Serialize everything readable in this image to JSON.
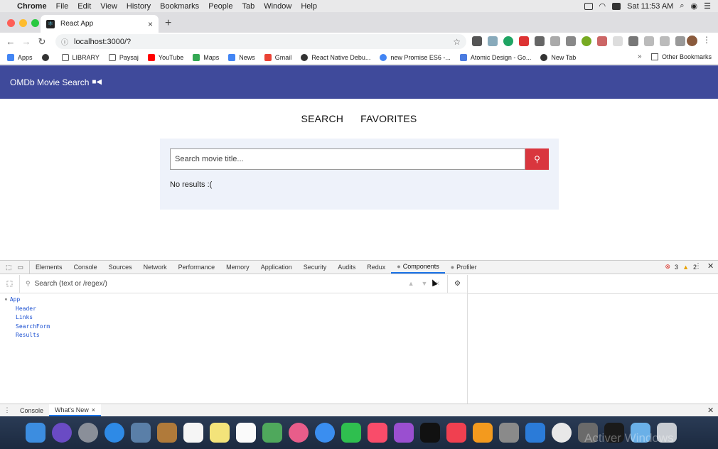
{
  "menubar": {
    "items": [
      "Chrome",
      "File",
      "Edit",
      "View",
      "History",
      "Bookmarks",
      "People",
      "Tab",
      "Window",
      "Help"
    ],
    "clock": "Sat 11:53 AM"
  },
  "browser": {
    "tab_title": "React App",
    "url": "localhost:3000/?"
  },
  "bookmarks": [
    "Apps",
    "LIBRARY",
    "Paysaj",
    "YouTube",
    "Maps",
    "News",
    "Gmail",
    "React Native Debu...",
    "new Promise ES6 -...",
    "Atomic Design - Go...",
    "New Tab"
  ],
  "bookmarks_right": "Other Bookmarks",
  "app": {
    "brand": "OMDb Movie Search",
    "nav": [
      "SEARCH",
      "FAVORITES"
    ],
    "search_placeholder": "Search movie title...",
    "no_results": "No results :("
  },
  "devtools": {
    "tabs": [
      "Elements",
      "Console",
      "Sources",
      "Network",
      "Performance",
      "Memory",
      "Application",
      "Security",
      "Audits",
      "Redux",
      "Components",
      "Profiler"
    ],
    "active_tab": "Components",
    "error_count": "3",
    "warning_count": "2",
    "search_placeholder": "Search (text or /regex/)",
    "tree_root": "App",
    "tree_children": [
      "Header",
      "Links",
      "SearchForm",
      "Results"
    ],
    "drawer_tabs": [
      "Console",
      "What's New"
    ]
  },
  "watermark": "Activer Windows",
  "colors": {
    "header": "#3f4a9b",
    "search_button": "#d9363e",
    "panel": "#eef2fa"
  }
}
